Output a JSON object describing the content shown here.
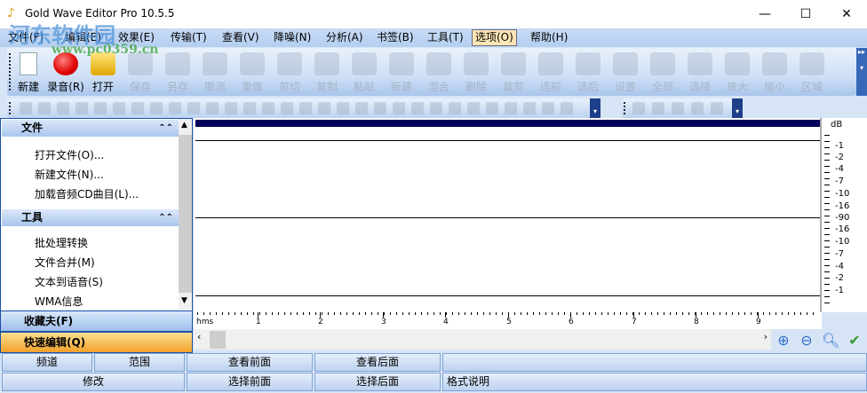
{
  "window": {
    "title": "Gold Wave Editor Pro 10.5.5",
    "minimize": "—",
    "maximize": "☐",
    "close": "✕"
  },
  "watermark": {
    "line1": "河东软件园",
    "line2": "www.pc0359.cn"
  },
  "menu": [
    "文件(F)",
    "编辑(E)",
    "效果(E)",
    "传输(T)",
    "查看(V)",
    "降噪(N)",
    "分析(A)",
    "书签(B)",
    "工具(T)",
    "选项(O)",
    "帮助(H)"
  ],
  "toolbar": [
    "新建",
    "录音(R)",
    "打开",
    "保存",
    "另存",
    "撤消",
    "重做",
    "剪切",
    "复制",
    "粘贴",
    "新建",
    "混合",
    "删除",
    "裁剪",
    "选前",
    "选后",
    "设置",
    "全部",
    "选择",
    "放大",
    "缩小",
    "区域"
  ],
  "left_panel": {
    "file_section": {
      "title": "文件",
      "items": [
        "打开文件(O)...",
        "新建文件(N)...",
        "加载音频CD曲目(L)..."
      ]
    },
    "tools_section": {
      "title": "工具",
      "items": [
        "批处理转换",
        "文件合并(M)",
        "文本到语音(S)",
        "WMA信息"
      ]
    },
    "favorites": "收藏夫(F)",
    "quick_edit": "快速编辑(Q)"
  },
  "db_scale": {
    "unit": "dB",
    "labels": [
      "-1",
      "-2",
      "-4",
      "-7",
      "-10",
      "-16",
      "-90",
      "-16",
      "-10",
      "-7",
      "-4",
      "-2",
      "-1"
    ]
  },
  "time_ruler": {
    "unit": "hms",
    "labels": [
      "1",
      "2",
      "3",
      "4",
      "5",
      "6",
      "7",
      "8",
      "9"
    ]
  },
  "bottom": {
    "row1": [
      "频道",
      "范围",
      "查看前面",
      "查看后面",
      ""
    ],
    "row2": [
      "修改",
      "选择前面",
      "选择后面",
      "格式说明"
    ]
  },
  "colors": {
    "accent": "#1a4fa8",
    "quick_edit": "#f5a623",
    "wave_top": "#00005a"
  }
}
